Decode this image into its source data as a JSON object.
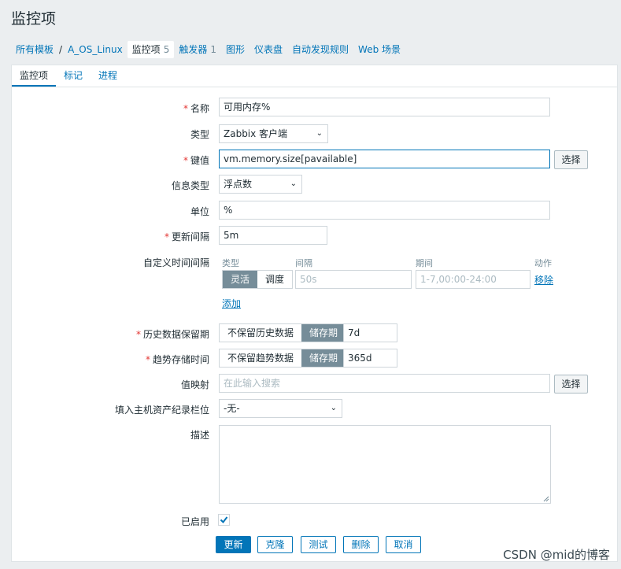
{
  "page": {
    "title": "监控项"
  },
  "breadcrumb": {
    "all_templates": "所有模板",
    "separator": "/",
    "host": "A_OS_Linux",
    "items": "监控项",
    "items_count": "5",
    "triggers": "触发器",
    "triggers_count": "1",
    "graphs": "图形",
    "dashboards": "仪表盘",
    "discovery": "自动发现规则",
    "web": "Web 场景"
  },
  "tabs": [
    "监控项",
    "标记",
    "进程"
  ],
  "form": {
    "name": {
      "label": "名称",
      "value": "可用内存%"
    },
    "type": {
      "label": "类型",
      "value": "Zabbix 客户端"
    },
    "key": {
      "label": "键值",
      "value": "vm.memory.size[pavailable]",
      "button": "选择"
    },
    "info_type": {
      "label": "信息类型",
      "value": "浮点数"
    },
    "units": {
      "label": "单位",
      "value": "%"
    },
    "interval": {
      "label": "更新间隔",
      "value": "5m"
    },
    "custom_intervals": {
      "label": "自定义时间间隔",
      "col_type": "类型",
      "col_interval": "间隔",
      "col_period": "期间",
      "col_action": "动作",
      "flexible": "灵活",
      "scheduling": "调度",
      "interval_placeholder": "50s",
      "period_placeholder": "1-7,00:00-24:00",
      "remove": "移除",
      "add": "添加"
    },
    "history": {
      "label": "历史数据保留期",
      "off": "不保留历史数据",
      "on": "储存期",
      "value": "7d"
    },
    "trends": {
      "label": "趋势存储时间",
      "off": "不保留趋势数据",
      "on": "储存期",
      "value": "365d"
    },
    "valuemap": {
      "label": "值映射",
      "placeholder": "在此输入搜索",
      "button": "选择"
    },
    "inventory": {
      "label": "填入主机资产纪录栏位",
      "value": "-无-"
    },
    "description": {
      "label": "描述",
      "value": ""
    },
    "enabled": {
      "label": "已启用",
      "checked": true
    }
  },
  "actions": {
    "update": "更新",
    "clone": "克隆",
    "test": "测试",
    "delete": "删除",
    "cancel": "取消"
  },
  "watermark": "CSDN @mid的博客"
}
